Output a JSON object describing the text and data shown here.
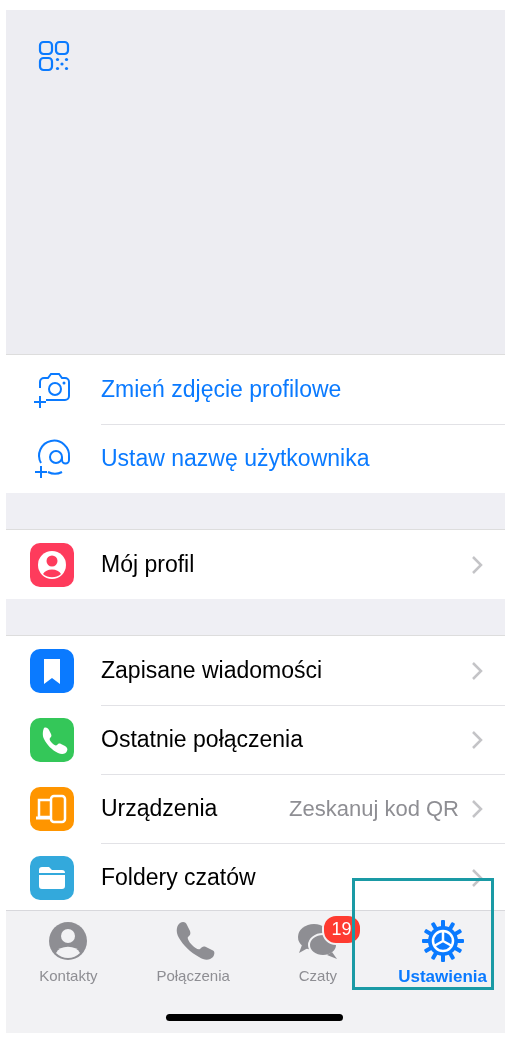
{
  "actions": [
    {
      "label": "Zmień zdjęcie profilowe"
    },
    {
      "label": "Ustaw nazwę użytkownika"
    }
  ],
  "sections": [
    {
      "items": [
        {
          "label": "Mój profil",
          "color": "#fe3b5c"
        }
      ]
    },
    {
      "items": [
        {
          "label": "Zapisane wiadomości",
          "color": "#0a7aff"
        },
        {
          "label": "Ostatnie połączenia",
          "color": "#34c759"
        },
        {
          "label": "Urządzenia",
          "value": "Zeskanuj kod QR",
          "color": "#ff9500"
        },
        {
          "label": "Foldery czatów",
          "color": "#33a9dc"
        }
      ]
    }
  ],
  "tabs": [
    {
      "label": "Kontakty",
      "selected": false,
      "highlighted": false
    },
    {
      "label": "Połączenia",
      "selected": false,
      "highlighted": false
    },
    {
      "label": "Czaty",
      "selected": false,
      "highlighted": false,
      "badge": "19"
    },
    {
      "label": "Ustawienia",
      "selected": true,
      "highlighted": true
    }
  ]
}
